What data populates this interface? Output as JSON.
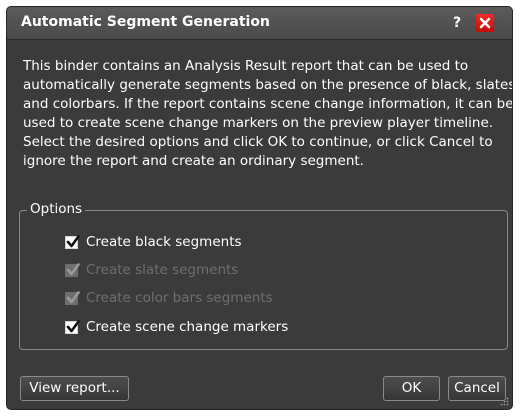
{
  "dialog": {
    "title": "Automatic Segment Generation",
    "help_label": "?",
    "close_icon": "close-icon",
    "message_lines": [
      "This binder contains an Analysis Result report that can be used to",
      "automatically generate segments based on the presence of black, slates",
      "and colorbars. If the report contains scene change information, it can be",
      "used to create scene change markers on the preview player timeline.",
      "Select the desired options and click OK to continue, or click Cancel to",
      "ignore the report and create an ordinary segment."
    ],
    "options": {
      "legend": "Options",
      "items": [
        {
          "label": "Create black segments",
          "checked": true,
          "enabled": true
        },
        {
          "label": "Create slate segments",
          "checked": true,
          "enabled": false
        },
        {
          "label": "Create color bars segments",
          "checked": true,
          "enabled": false
        },
        {
          "label": "Create scene change markers",
          "checked": true,
          "enabled": true
        }
      ]
    },
    "buttons": {
      "view_report": "View report...",
      "ok": "OK",
      "cancel": "Cancel"
    }
  },
  "colors": {
    "background": "#3b3b3b",
    "close_red": "#e01b1b",
    "disabled_text": "#6e6e6e",
    "text": "#ffffff"
  }
}
